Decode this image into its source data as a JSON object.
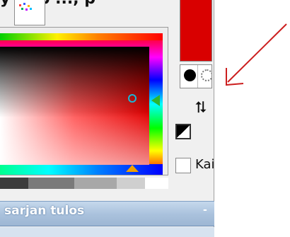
{
  "caption": {
    "text": "y ... p ..., p"
  },
  "palette_tab": {
    "icon": "dotted-palette-icon"
  },
  "color_square": {
    "icon_cursor": "circle-cursor-icon",
    "icon_hue_marker": "green-triangle-marker-icon",
    "icon_saturation_marker": "orange-triangle-marker-icon"
  },
  "gray_strip": {
    "swatches": [
      "#3c3c3c",
      "#7a7a7a",
      "#a8a8a8",
      "#cfcfcf",
      "#ffffff"
    ]
  },
  "results_panel": {
    "title": "sarjan tulos",
    "close_label": "-"
  },
  "current_color": {
    "hex": "#d90000"
  },
  "alpha_controls": {
    "opaque_icon": "filled-circle-icon",
    "transparent_icon": "dotted-circle-icon"
  },
  "swap_icon": {
    "glyph": "⮁"
  },
  "fg_bg_icon": {
    "name": "black-white-swatch-icon"
  },
  "keep_checkbox": {
    "label": "Kai",
    "checked": false
  },
  "annotation": {
    "color": "#cc1f1f",
    "icon": "arrow-icon"
  }
}
